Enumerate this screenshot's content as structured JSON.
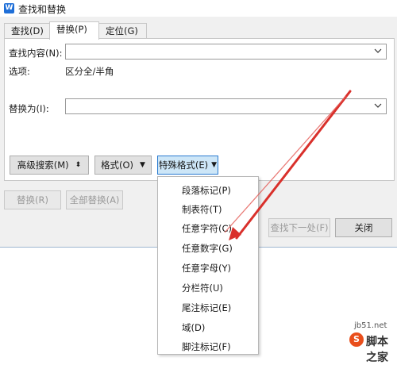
{
  "window": {
    "title": "查找和替换",
    "app_icon_letter": "W"
  },
  "tabs": [
    {
      "label": "查找(D)",
      "active": false
    },
    {
      "label": "替换(P)",
      "active": true
    },
    {
      "label": "定位(G)",
      "active": false
    }
  ],
  "find": {
    "label": "查找内容(N):",
    "value": ""
  },
  "options": {
    "label": "选项:",
    "value": "区分全/半角"
  },
  "replace": {
    "label": "替换为(I):",
    "value": ""
  },
  "buttons": {
    "advanced_search": "高级搜索(M)",
    "format": "格式(O)",
    "special_format": "特殊格式(E)",
    "replace": "替换(R)",
    "replace_all": "全部替换(A)",
    "find_next": "查找下一处(F)",
    "close": "关闭"
  },
  "special_menu": {
    "items": [
      "段落标记(P)",
      "制表符(T)",
      "任意字符(C)",
      "任意数字(G)",
      "任意字母(Y)",
      "分栏符(U)",
      "尾注标记(E)",
      "域(D)",
      "脚注标记(F)"
    ]
  },
  "watermark": {
    "url": "jb51.net",
    "text": "脚本之家",
    "icon_letter": "S"
  },
  "colors": {
    "accent": "#2b7bd0",
    "arrow": "#d9302b",
    "menu_active_button": "#cde6f7"
  }
}
